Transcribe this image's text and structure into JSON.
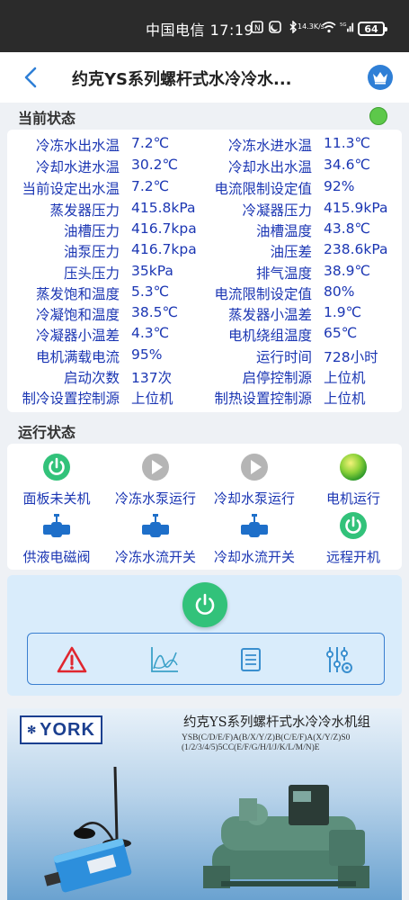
{
  "status_bar": {
    "carrier": "中国电信",
    "time": "17:19",
    "net_speed_value": "14.3",
    "net_speed_unit": "K/s",
    "battery": "64"
  },
  "header": {
    "title": "约克YS系列螺杆式水冷冷水..."
  },
  "current_status": {
    "title": "当前状态",
    "rows": [
      {
        "l1": "冷冻水出水温",
        "v1": "7.2℃",
        "l2": "冷冻水进水温",
        "v2": "11.3℃"
      },
      {
        "l1": "冷却水进水温",
        "v1": "30.2℃",
        "l2": "冷却水出水温",
        "v2": "34.6℃"
      },
      {
        "l1": "当前设定出水温",
        "v1": "7.2℃",
        "l2": "电流限制设定值",
        "v2": "92%"
      },
      {
        "l1": "蒸发器压力",
        "v1": "415.8kPa",
        "l2": "冷凝器压力",
        "v2": "415.9kPa"
      },
      {
        "l1": "油槽压力",
        "v1": "416.7kpa",
        "l2": "油槽温度",
        "v2": "43.8℃"
      },
      {
        "l1": "油泵压力",
        "v1": "416.7kpa",
        "l2": "油压差",
        "v2": "238.6kPa"
      },
      {
        "l1": "压头压力",
        "v1": "35kPa",
        "l2": "排气温度",
        "v2": "38.9℃"
      },
      {
        "l1": "蒸发饱和温度",
        "v1": "5.3℃",
        "l2": "电流限制设定值",
        "v2": "80%"
      },
      {
        "l1": "冷凝饱和温度",
        "v1": "38.5℃",
        "l2": "蒸发器小温差",
        "v2": "1.9℃"
      },
      {
        "l1": "冷凝器小温差",
        "v1": "4.3℃",
        "l2": "电机绕组温度",
        "v2": "65℃"
      },
      {
        "l1": "电机满载电流",
        "v1": "95%",
        "l2": "运行时间",
        "v2": "728小时"
      },
      {
        "l1": "启动次数",
        "v1": "137次",
        "l2": "启停控制源",
        "v2": "上位机"
      },
      {
        "l1": "制冷设置控制源",
        "v1": "上位机",
        "l2": "制热设置控制源",
        "v2": "上位机"
      }
    ]
  },
  "run_state": {
    "title": "运行状态",
    "items": [
      {
        "label": "面板未关机",
        "icon": "power-icon"
      },
      {
        "label": "冷冻水泵运行",
        "icon": "play-icon"
      },
      {
        "label": "冷却水泵运行",
        "icon": "play-icon"
      },
      {
        "label": "电机运行",
        "icon": "motor-status-icon"
      },
      {
        "label": "供液电磁阀",
        "icon": "valve-icon"
      },
      {
        "label": "冷冻水流开关",
        "icon": "valve-icon"
      },
      {
        "label": "冷却水流开关",
        "icon": "valve-icon"
      },
      {
        "label": "远程开机",
        "icon": "power-icon"
      }
    ]
  },
  "controls": {
    "power_icon": "power-icon",
    "tools": [
      "alarm-icon",
      "trend-chart-icon",
      "list-icon",
      "settings-sliders-icon"
    ]
  },
  "banner": {
    "logo": "YORK",
    "title": "约克YS系列螺杆式水冷冷水机组",
    "model_line1": "YSB(C/D/E/F)A(B/X/Y/Z)B(C/E/F)A(X/Y/Z)S0",
    "model_line2": "(1/2/3/4/5)5CC(E/F/G/H/I/J/K/L/M/N)E"
  },
  "colors": {
    "label_blue": "#1b36b3",
    "green": "#32c27a",
    "gray": "#8a8a8a",
    "accent_blue": "#2f7fd6"
  }
}
